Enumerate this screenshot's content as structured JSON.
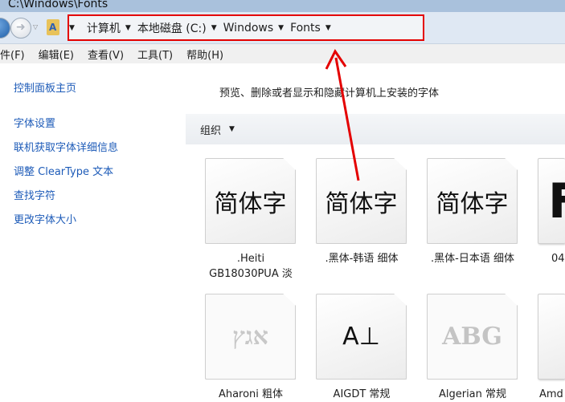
{
  "window": {
    "title": "C:\\Windows\\Fonts"
  },
  "address": {
    "crumbs": [
      "计算机",
      "本地磁盘 (C:)",
      "Windows",
      "Fonts"
    ]
  },
  "menu": [
    "件(F)",
    "编辑(E)",
    "查看(V)",
    "工具(T)",
    "帮助(H)"
  ],
  "sidebar": {
    "items": [
      "控制面板主页",
      "字体设置",
      "联机获取字体详细信息",
      "调整 ClearType 文本",
      "查找字符",
      "更改字体大小"
    ]
  },
  "main": {
    "description": "预览、删除或者显示和隐藏计算机上安装的字体",
    "organize": "组织"
  },
  "fonts": [
    {
      "name": ".Heiti GB18030PUA 淡",
      "sample": "简体字"
    },
    {
      "name": ".黑体-韩语 细体",
      "sample": "简体字"
    },
    {
      "name": ".黑体-日本语 细体",
      "sample": "简体字"
    },
    {
      "name": "04",
      "sample": "F"
    },
    {
      "name": "Aharoni 粗体",
      "sample": "אגץ"
    },
    {
      "name": "AIGDT 常规",
      "sample": "A⊥"
    },
    {
      "name": "Algerian 常规",
      "sample": "ABG"
    },
    {
      "name": "Amd",
      "sample": ""
    }
  ],
  "annotation": {
    "color": "#e40000"
  }
}
